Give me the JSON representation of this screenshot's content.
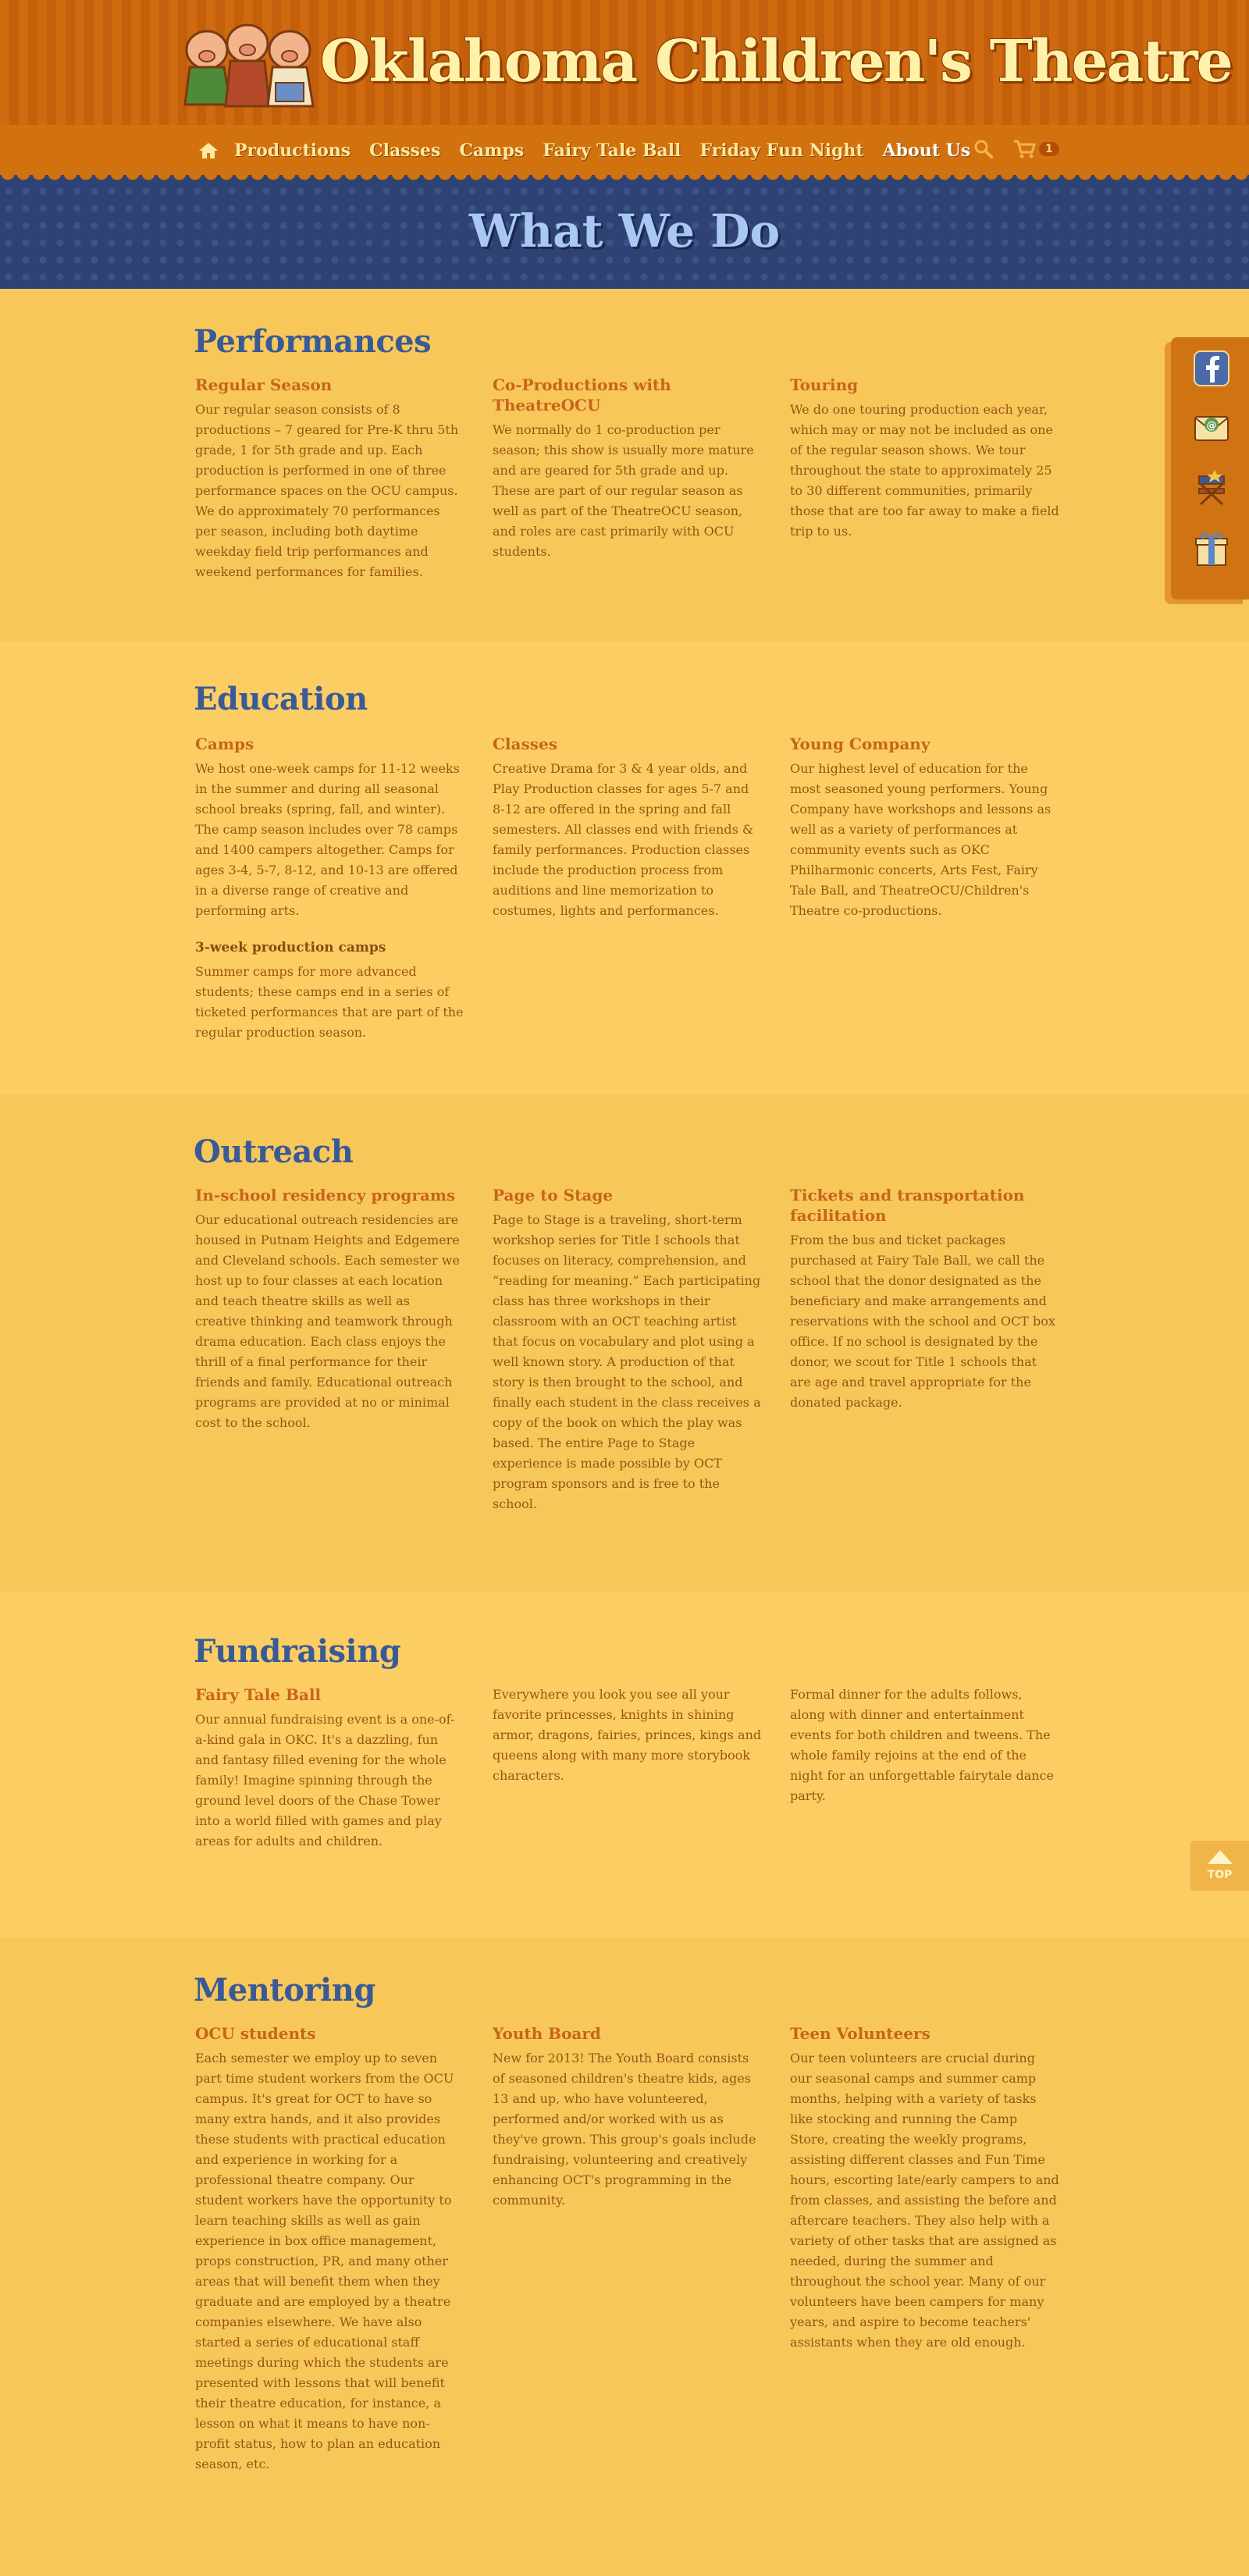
{
  "header": {
    "logo_text": "Oklahoma Children's Theatre"
  },
  "nav": {
    "home_icon": "home-icon",
    "items": [
      "Productions",
      "Classes",
      "Camps",
      "Fairy Tale Ball",
      "Friday Fun Night",
      "About Us"
    ],
    "active": "About Us",
    "cart_count": "1"
  },
  "hero": {
    "title": "What We Do"
  },
  "sections": {
    "performances": {
      "title": "Performances",
      "cols": [
        {
          "heading": "Regular Season",
          "text": "Our regular season consists of 8 productions – 7 geared for Pre-K thru 5th grade, 1 for 5th grade and up. Each production is performed in one of three performance spaces on the OCU campus. We do approximately 70 performances per season, including both daytime weekday field trip performances and weekend performances for families."
        },
        {
          "heading": "Co-Productions with TheatreOCU",
          "text": "We normally do 1 co-production per season; this show is usually more mature and are geared for 5th grade and up. These are part of our regular season as well as part of the TheatreOCU season, and roles are cast primarily with OCU students."
        },
        {
          "heading": "Touring",
          "text": "We do one touring production each year, which may or may not be included as one of the regular season shows. We tour throughout the state to approximately 25 to 30 different communities, primarily those that are too far away to make a field trip to us."
        }
      ]
    },
    "education": {
      "title": "Education",
      "cols": [
        {
          "heading": "Camps",
          "text": "We host one-week camps for 11-12 weeks in the summer and during all seasonal school breaks (spring, fall, and winter). The camp season includes over 78 camps and 1400 campers altogether. Camps for ages 3-4, 5-7, 8-12, and 10-13 are offered in a diverse range of creative and performing arts.",
          "subheading": "3-week production camps",
          "subtext": "Summer camps for more advanced students; these camps end in a series of ticketed performances that are part of the regular production season."
        },
        {
          "heading": "Classes",
          "text": "Creative Drama for 3 & 4 year olds, and Play Production classes for ages 5-7 and 8-12 are offered in the spring and fall semesters. All classes end with friends & family performances. Production classes include the production process from auditions and line memorization to costumes, lights and performances."
        },
        {
          "heading": "Young Company",
          "text": "Our highest level of education for the most seasoned young performers. Young Company have workshops and lessons as well as a variety of performances at community events such as OKC Philharmonic concerts, Arts Fest, Fairy Tale Ball, and TheatreOCU/Children's Theatre co-productions."
        }
      ]
    },
    "outreach": {
      "title": "Outreach",
      "cols": [
        {
          "heading": "In-school residency programs",
          "text": "Our educational outreach residencies are housed in Putnam Heights and Edgemere and Cleveland schools. Each semester we host up to four classes at each location and teach theatre skills as well as creative thinking and teamwork through drama education. Each class enjoys the thrill of a final performance for their friends and family. Educational outreach programs are provided at no or minimal cost to the school."
        },
        {
          "heading": "Page to Stage",
          "text": "Page to Stage is a traveling, short-term workshop series for Title I schools that focuses on literacy, comprehension, and “reading for meaning.” Each participating class has three workshops in their classroom with an OCT teaching artist that focus on vocabulary and plot using a well known story.  A production of that story is then brought to the school, and finally each student in the class receives a copy of the book on which the play was based. The entire Page to Stage experience is made possible by OCT program sponsors and is free to the school."
        },
        {
          "heading": "Tickets and transportation facilitation",
          "text": "From the bus and ticket packages purchased at Fairy Tale Ball, we call the school that the donor designated as the beneficiary and make arrangements and reservations with the school and OCT box office. If no school is designated by the donor, we scout for Title 1 schools that are age and travel appropriate for the donated package."
        }
      ]
    },
    "fundraising": {
      "title": "Fundraising",
      "cols": [
        {
          "heading": "Fairy Tale Ball",
          "text": "Our annual fundraising event is a one-of-a-kind gala in OKC. It's a dazzling, fun and fantasy filled evening for the whole family! Imagine spinning through the ground level doors of the Chase Tower into a world filled with games and play areas for adults and children."
        },
        {
          "heading": "",
          "text": "Everywhere you look you see all your favorite princesses, knights in shining armor, dragons, fairies, princes, kings and queens along with many more storybook characters."
        },
        {
          "heading": "",
          "text": "Formal dinner for the adults follows, along with dinner and entertainment events for both children and tweens. The whole family rejoins at the end of the night for an unforgettable fairytale dance party."
        }
      ]
    },
    "mentoring": {
      "title": "Mentoring",
      "cols": [
        {
          "heading": "OCU students",
          "text": "Each semester we employ up to seven part time student workers from the OCU campus. It's great for OCT to have so many extra hands, and it also provides these students with practical education and experience in working for a professional theatre company. Our student workers have the opportunity to learn teaching skills as well as gain experience in box office management, props construction, PR, and many other areas that will benefit them when they graduate and are employed by a theatre companies elsewhere. We have also started a series of educational staff meetings during which the students are presented with lessons that will benefit their theatre education, for instance, a lesson on what it means to have non-profit status, how to plan an education season, etc."
        },
        {
          "heading": "Youth Board",
          "text": "New for 2013! The Youth Board consists of seasoned children's theatre kids, ages 13 and up, who have volunteered, performed and/or worked with us as they've grown. This group's goals include fundraising, volunteering and creatively enhancing OCT's programming in the community."
        },
        {
          "heading": "Teen Volunteers",
          "text": "Our teen volunteers are crucial during our seasonal camps and summer camp months, helping with a variety of tasks like stocking and running the Camp Store, creating the weekly programs, assisting different classes and Fun Time hours, escorting late/early campers to and from classes, and assisting the before and aftercare teachers. They also help with a variety of other tasks that are assigned as needed, during the summer and throughout the school year. Many of our volunteers have been campers for many years, and aspire to become teachers' assistants when they are old enough."
        }
      ]
    }
  },
  "social": [
    "facebook-icon",
    "email-icon",
    "directors-chair-icon",
    "gift-icon"
  ],
  "top_button": "TOP",
  "colors": {
    "header_orange": "#cf6a10",
    "hero_navy": "#2f4274",
    "heading_blue": "#3a5a96",
    "subheading_orange": "#c8641a",
    "body_text": "#9a5312",
    "page_yellow": "#f7c75a"
  }
}
